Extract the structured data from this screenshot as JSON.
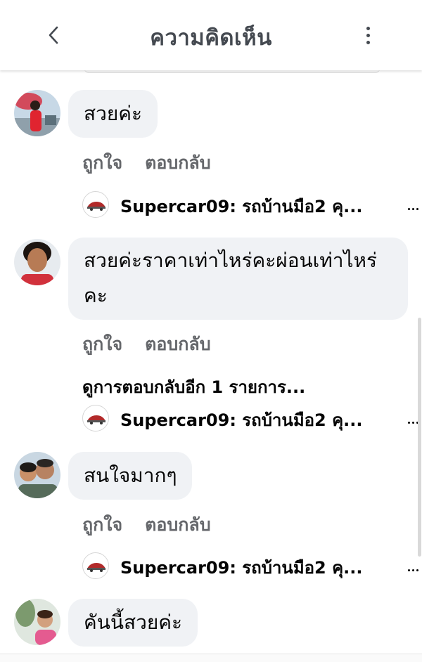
{
  "header": {
    "title": "ความคิดเห็น",
    "back_icon": "chevron-left-icon",
    "more_icon": "vertical-dots-icon"
  },
  "actions": {
    "like": "ถูกใจ",
    "reply": "ตอบกลับ"
  },
  "comments": [
    {
      "text": "สวยค่ะ",
      "reply_preview": "Supercar09: รถบ้านมือ2 คุ..."
    },
    {
      "text": "สวยค่ะราคาเท่าไหร่คะผ่อนเท่าไหร่คะ",
      "more_replies": "ดูการตอบกลับอีก 1 รายการ...",
      "reply_preview": "Supercar09: รถบ้านมือ2 คุ..."
    },
    {
      "text": "สนใจมากๆ",
      "reply_preview": "Supercar09: รถบ้านมือ2 คุ..."
    },
    {
      "text": "คันนี้สวยค่ะ"
    }
  ],
  "colors": {
    "bubble": "#f0f2f5",
    "secondary_text": "#65676b",
    "primary_text": "#050505",
    "header_text": "#444950"
  }
}
